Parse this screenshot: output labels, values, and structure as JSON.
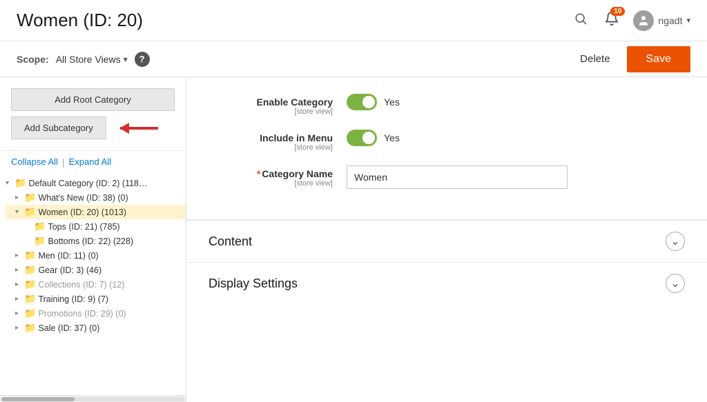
{
  "header": {
    "title": "Women (ID: 20)",
    "notification_count": "10",
    "username": "ngadt"
  },
  "scope_bar": {
    "scope_label": "Scope:",
    "scope_value": "All Store Views",
    "delete_label": "Delete",
    "save_label": "Save"
  },
  "left_panel": {
    "add_root_label": "Add Root Category",
    "add_sub_label": "Add Subcategory",
    "collapse_label": "Collapse All",
    "expand_label": "Expand All",
    "tree": [
      {
        "id": "default",
        "label": "Default Category (ID: 2) (118…",
        "indent": 1,
        "open": true,
        "selected": false,
        "muted": false
      },
      {
        "id": "whatsnew",
        "label": "What's New (ID: 38) (0)",
        "indent": 2,
        "open": false,
        "selected": false,
        "muted": false
      },
      {
        "id": "women",
        "label": "Women (ID: 20) (1013)",
        "indent": 2,
        "open": true,
        "selected": true,
        "muted": false
      },
      {
        "id": "tops",
        "label": "Tops (ID: 21) (785)",
        "indent": 3,
        "open": false,
        "selected": false,
        "muted": false
      },
      {
        "id": "bottoms",
        "label": "Bottoms (ID: 22) (228)",
        "indent": 3,
        "open": false,
        "selected": false,
        "muted": false
      },
      {
        "id": "men",
        "label": "Men (ID: 11) (0)",
        "indent": 2,
        "open": false,
        "selected": false,
        "muted": false
      },
      {
        "id": "gear",
        "label": "Gear (ID: 3) (46)",
        "indent": 2,
        "open": false,
        "selected": false,
        "muted": false
      },
      {
        "id": "collections",
        "label": "Collections (ID: 7) (12)",
        "indent": 2,
        "open": false,
        "selected": false,
        "muted": true
      },
      {
        "id": "training",
        "label": "Training (ID: 9) (7)",
        "indent": 2,
        "open": false,
        "selected": false,
        "muted": false
      },
      {
        "id": "promotions",
        "label": "Promotions (ID: 29) (0)",
        "indent": 2,
        "open": false,
        "selected": false,
        "muted": true
      },
      {
        "id": "sale",
        "label": "Sale (ID: 37) (0)",
        "indent": 2,
        "open": false,
        "selected": false,
        "muted": false
      }
    ]
  },
  "form": {
    "enable_label": "Enable Category",
    "enable_sublabel": "[store view]",
    "enable_value": "Yes",
    "menu_label": "Include in Menu",
    "menu_sublabel": "[store view]",
    "menu_value": "Yes",
    "name_label": "Category Name",
    "name_sublabel": "[store view]",
    "name_value": "Women"
  },
  "sections": [
    {
      "id": "content",
      "title": "Content"
    },
    {
      "id": "display",
      "title": "Display Settings"
    }
  ]
}
